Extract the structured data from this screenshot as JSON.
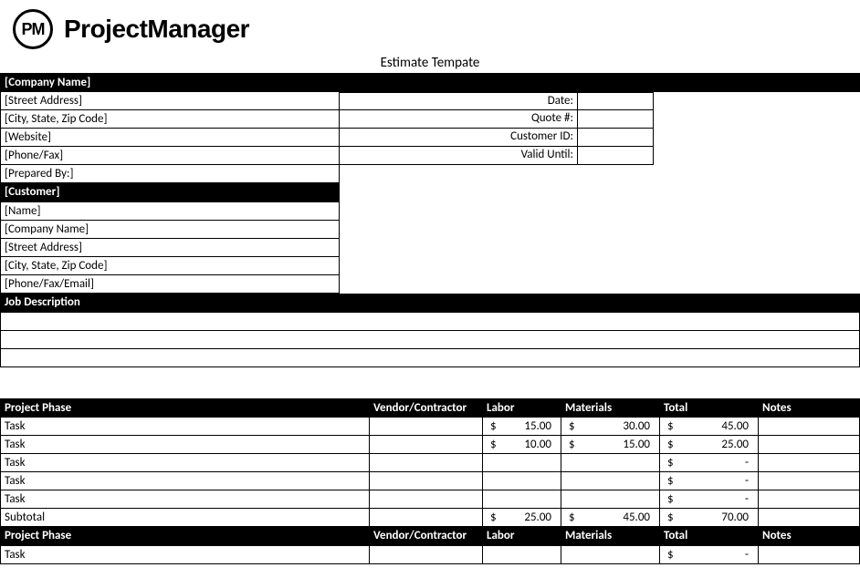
{
  "logo": {
    "badge": "PM",
    "text": "ProjectManager"
  },
  "doc_title": "Estimate Tempate",
  "company_section": {
    "header": "[Company Name]",
    "rows": [
      "[Street Address]",
      "[City, State, Zip Code]",
      "[Website]",
      "[Phone/Fax]",
      "[Prepared By:]"
    ]
  },
  "meta": {
    "labels": [
      "Date:",
      "Quote #:",
      "Customer ID:",
      "Valid Until:"
    ],
    "values": [
      "",
      "",
      "",
      ""
    ]
  },
  "customer_section": {
    "header": "[Customer]",
    "rows": [
      "[Name]",
      "[Company Name]",
      "[Street Address]",
      "[City, State, Zip Code]",
      "[Phone/Fax/Email]"
    ]
  },
  "job_desc_header": "Job Description",
  "phase1": {
    "headers": {
      "phase": "Project Phase",
      "vendor": "Vendor/Contractor",
      "labor": "Labor",
      "materials": "Materials",
      "total": "Total",
      "notes": "Notes"
    },
    "rows": [
      {
        "task": "Task",
        "vendor": "",
        "labor": "15.00",
        "materials": "30.00",
        "total": "45.00",
        "notes": ""
      },
      {
        "task": "Task",
        "vendor": "",
        "labor": "10.00",
        "materials": "15.00",
        "total": "25.00",
        "notes": ""
      },
      {
        "task": "Task",
        "vendor": "",
        "labor": "",
        "materials": "",
        "total": "-",
        "notes": ""
      },
      {
        "task": "Task",
        "vendor": "",
        "labor": "",
        "materials": "",
        "total": "-",
        "notes": ""
      },
      {
        "task": "Task",
        "vendor": "",
        "labor": "",
        "materials": "",
        "total": "-",
        "notes": ""
      }
    ],
    "subtotal": {
      "label": "Subtotal",
      "labor": "25.00",
      "materials": "45.00",
      "total": "70.00"
    }
  },
  "phase2": {
    "headers": {
      "phase": "Project Phase",
      "vendor": "Vendor/Contractor",
      "labor": "Labor",
      "materials": "Materials",
      "total": "Total",
      "notes": "Notes"
    },
    "rows": [
      {
        "task": "Task",
        "vendor": "",
        "labor": "",
        "materials": "",
        "total": "-",
        "notes": ""
      }
    ]
  },
  "currency": "$"
}
